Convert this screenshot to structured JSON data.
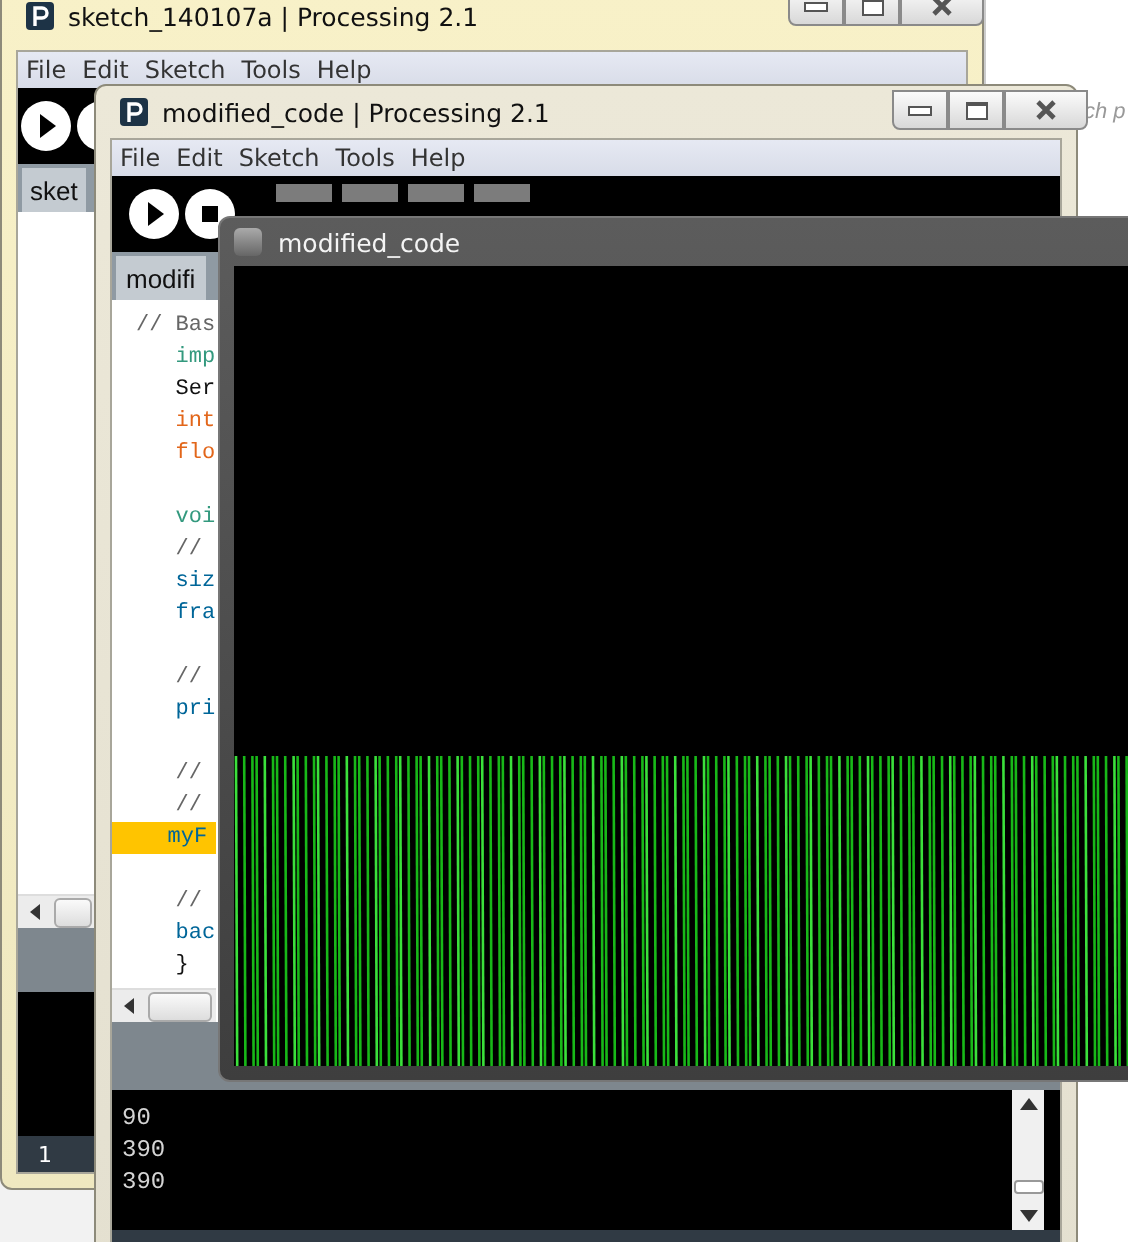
{
  "background": {
    "search_text": "ch p"
  },
  "editor_windows": [
    {
      "title": "sketch_140107a | Processing 2.1",
      "menu": [
        "File",
        "Edit",
        "Sketch",
        "Tools",
        "Help"
      ],
      "tab": "sket",
      "line_number": "1"
    },
    {
      "title": "modified_code | Processing 2.1",
      "menu": [
        "File",
        "Edit",
        "Sketch",
        "Tools",
        "Help"
      ],
      "tab": "modifi",
      "code_lines": [
        {
          "text": "// Bas",
          "kind": "comment",
          "highlighted": false
        },
        {
          "text": "   imp",
          "kind": "keyword",
          "highlighted": false
        },
        {
          "text": "   Ser",
          "kind": "plain",
          "highlighted": false
        },
        {
          "text": "   int",
          "kind": "type",
          "highlighted": false
        },
        {
          "text": "   flo",
          "kind": "type",
          "highlighted": false
        },
        {
          "kind": "blank",
          "highlighted": false
        },
        {
          "text": "   voi",
          "kind": "keyword",
          "highlighted": false
        },
        {
          "text": "   //",
          "kind": "comment",
          "highlighted": false
        },
        {
          "text": "   siz",
          "kind": "function",
          "highlighted": false
        },
        {
          "text": "   fra",
          "kind": "function",
          "highlighted": false
        },
        {
          "kind": "blank",
          "highlighted": false
        },
        {
          "text": "   //",
          "kind": "comment",
          "highlighted": false
        },
        {
          "text": "   pri",
          "kind": "function",
          "highlighted": false
        },
        {
          "kind": "blank",
          "highlighted": false
        },
        {
          "text": "   //",
          "kind": "comment",
          "highlighted": false
        },
        {
          "text": "   //",
          "kind": "comment",
          "highlighted": false
        },
        {
          "text": "   myF",
          "kind": "function",
          "highlighted": true
        },
        {
          "kind": "blank",
          "highlighted": false
        },
        {
          "text": "   //",
          "kind": "comment",
          "highlighted": false
        },
        {
          "text": "   bac",
          "kind": "function",
          "highlighted": false
        },
        {
          "text": "   }",
          "kind": "plain",
          "highlighted": false
        }
      ],
      "console_lines": [
        "90",
        "390",
        "390"
      ]
    }
  ],
  "sketch_window": {
    "title": "modified_code"
  }
}
